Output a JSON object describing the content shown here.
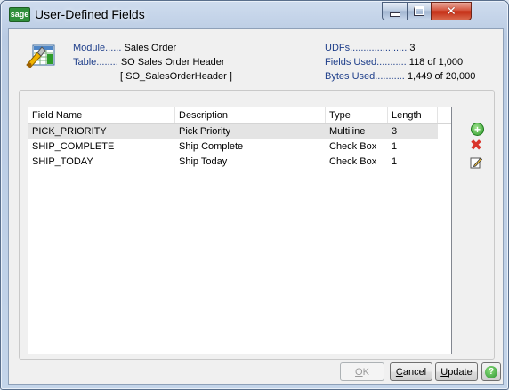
{
  "window": {
    "title": "User-Defined Fields",
    "app_icon_text": "sage",
    "controls": {
      "minimize": "minimize",
      "maximize": "maximize",
      "close": "close"
    }
  },
  "info": {
    "module_label": "Module......",
    "module_value": "Sales Order",
    "table_label": "Table........",
    "table_value": "SO Sales Order Header",
    "table_code": "[ SO_SalesOrderHeader ]",
    "udfs_label": "UDFs.....................",
    "udfs_value": "3",
    "fields_used_label": "Fields Used...........",
    "fields_used_value": "118 of 1,000",
    "bytes_used_label": "Bytes Used...........",
    "bytes_used_value": "1,449 of 20,000"
  },
  "grid": {
    "columns": [
      "Field Name",
      "Description",
      "Type",
      "Length"
    ],
    "rows": [
      {
        "field_name": "PICK_PRIORITY",
        "description": "Pick Priority",
        "type": "Multiline",
        "length": "3",
        "selected": true
      },
      {
        "field_name": "SHIP_COMPLETE",
        "description": "Ship Complete",
        "type": "Check Box",
        "length": "1",
        "selected": false
      },
      {
        "field_name": "SHIP_TODAY",
        "description": "Ship Today",
        "type": "Check Box",
        "length": "1",
        "selected": false
      }
    ]
  },
  "side_buttons": {
    "add": "add-icon",
    "delete": "delete-icon",
    "edit": "edit-icon"
  },
  "buttons": {
    "ok": {
      "accel": "O",
      "rest": "K",
      "enabled": false
    },
    "cancel": {
      "accel": "C",
      "rest": "ancel"
    },
    "update": {
      "accel": "U",
      "rest": "pdate"
    },
    "help": "?"
  },
  "colors": {
    "label_blue": "#1e3e8a",
    "add_green": "#2e9c2a",
    "delete_red": "#d9342a",
    "selected_row": "#e4e4e4"
  }
}
